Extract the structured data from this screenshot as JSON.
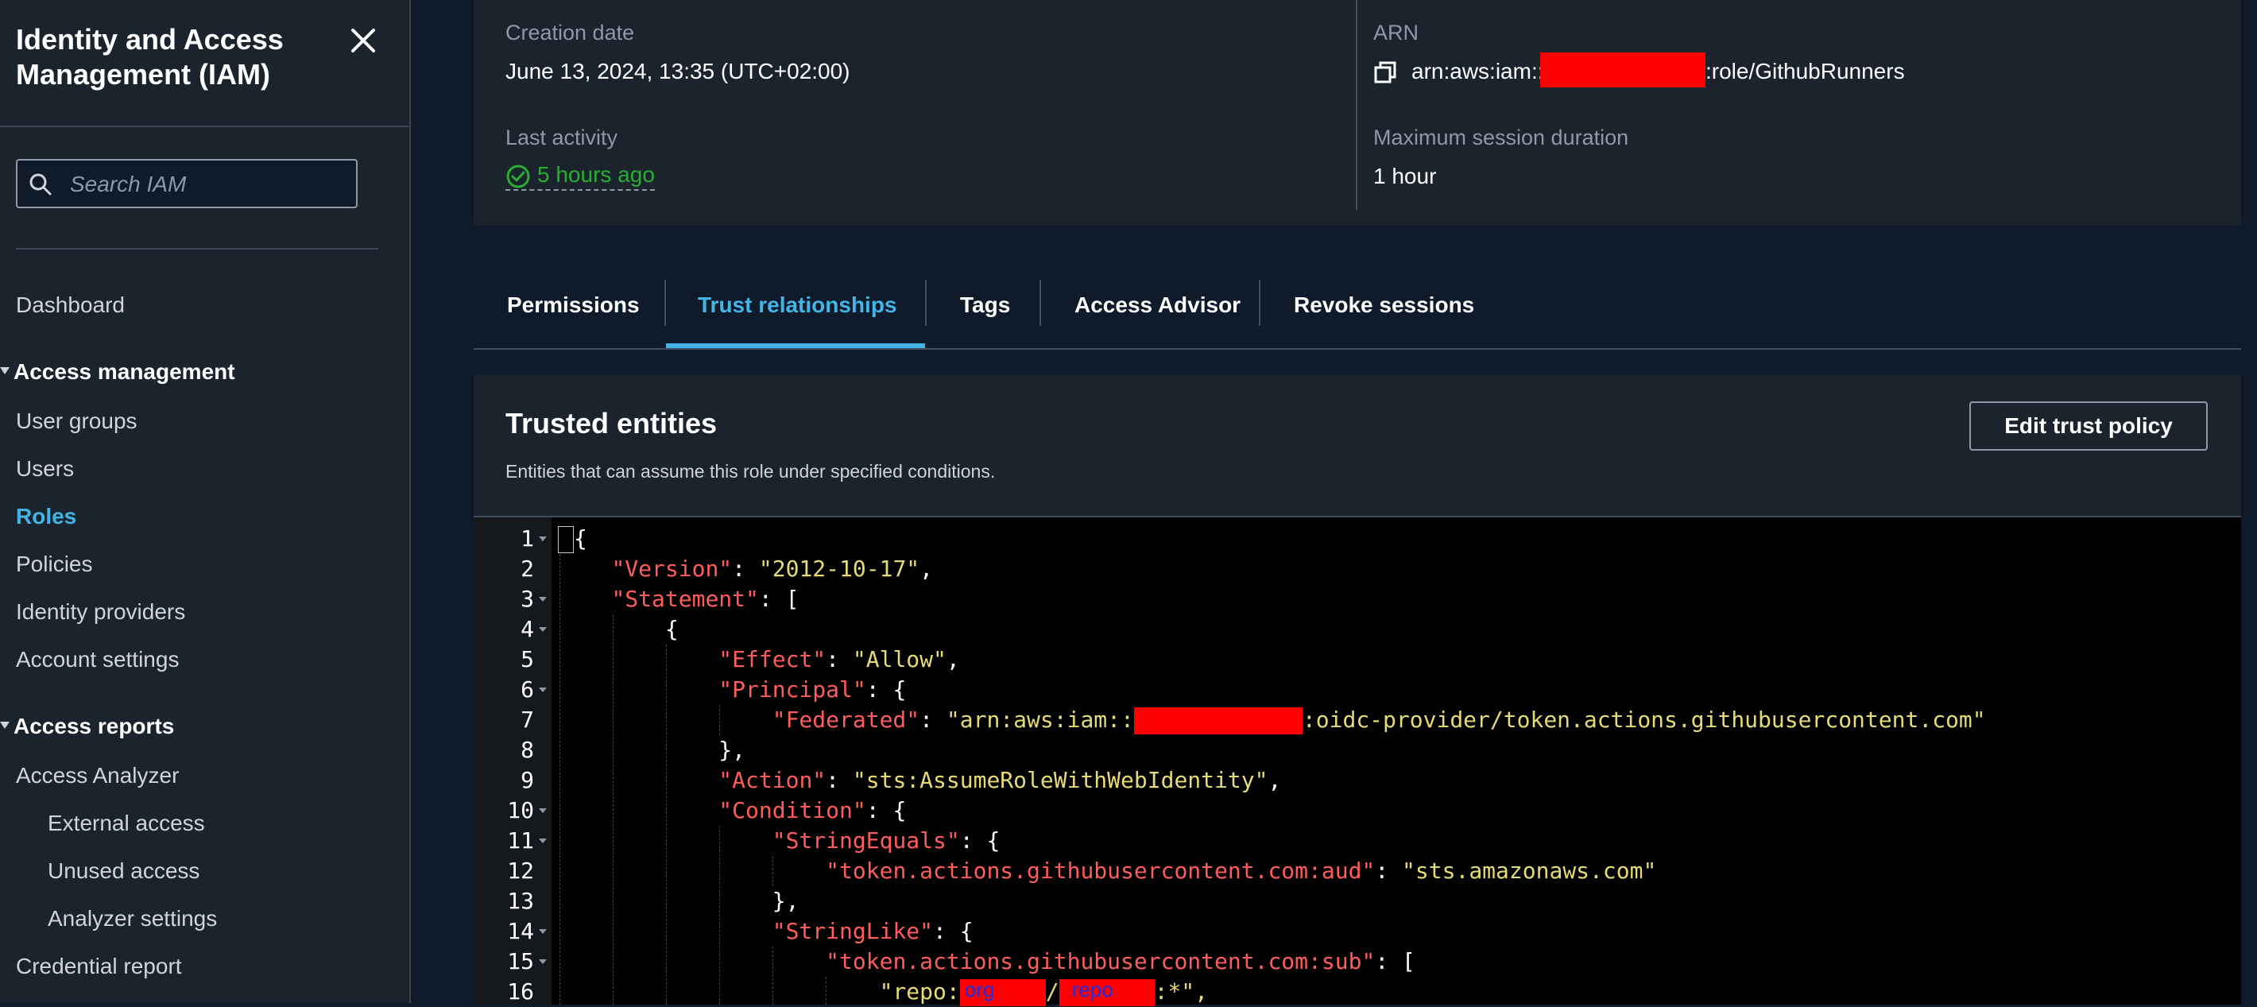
{
  "sidebar": {
    "title": "Identity and Access Management (IAM)",
    "search_placeholder": "Search IAM",
    "items": [
      {
        "label": "Dashboard"
      },
      {
        "label": "Access management"
      },
      {
        "label": "User groups"
      },
      {
        "label": "Users"
      },
      {
        "label": "Roles"
      },
      {
        "label": "Policies"
      },
      {
        "label": "Identity providers"
      },
      {
        "label": "Account settings"
      },
      {
        "label": "Access reports"
      },
      {
        "label": "Access Analyzer"
      },
      {
        "label": "External access"
      },
      {
        "label": "Unused access"
      },
      {
        "label": "Analyzer settings"
      },
      {
        "label": "Credential report"
      }
    ],
    "active_item": "Roles"
  },
  "details": {
    "creation_date_label": "Creation date",
    "creation_date": "June 13, 2024, 13:35 (UTC+02:00)",
    "last_activity_label": "Last activity",
    "last_activity": "5 hours ago",
    "arn_label": "ARN",
    "arn_prefix": "arn:aws:iam::",
    "arn_suffix": ":role/GithubRunners",
    "max_session_label": "Maximum session duration",
    "max_session": "1 hour"
  },
  "tabs": [
    {
      "label": "Permissions"
    },
    {
      "label": "Trust relationships"
    },
    {
      "label": "Tags"
    },
    {
      "label": "Access Advisor"
    },
    {
      "label": "Revoke sessions"
    }
  ],
  "active_tab": "Trust relationships",
  "trusted_entities": {
    "title": "Trusted entities",
    "description": "Entities that can assume this role under specified conditions.",
    "edit_button": "Edit trust policy"
  },
  "policy": {
    "line_numbers": [
      "1",
      "2",
      "3",
      "4",
      "5",
      "6",
      "7",
      "8",
      "9",
      "10",
      "11",
      "12",
      "13",
      "14",
      "15",
      "16"
    ],
    "version_key": "\"Version\"",
    "version_val": "\"2012-10-17\"",
    "statement_key": "\"Statement\"",
    "effect_key": "\"Effect\"",
    "effect_val": "\"Allow\"",
    "principal_key": "\"Principal\"",
    "federated_key": "\"Federated\"",
    "federated_prefix": "\"arn:aws:iam::",
    "federated_suffix": ":oidc-provider/token.actions.githubusercontent.com\"",
    "action_key": "\"Action\"",
    "action_val": "\"sts:AssumeRoleWithWebIdentity\"",
    "condition_key": "\"Condition\"",
    "string_equals_key": "\"StringEquals\"",
    "aud_key": "\"token.actions.githubusercontent.com:aud\"",
    "aud_val": "\"sts.amazonaws.com\"",
    "string_like_key": "\"StringLike\"",
    "sub_key": "\"token.actions.githubusercontent.com:sub\"",
    "repo_prefix": "\"repo:",
    "repo_org_label": "org",
    "repo_sep": "/",
    "repo_repo_label": "repo",
    "repo_suffix": ":*\","
  },
  "colors": {
    "accent": "#42b4e6",
    "success": "#29ad32",
    "json_key": "#ff5c5c",
    "json_string": "#e6db74",
    "redaction": "#ff0000"
  }
}
